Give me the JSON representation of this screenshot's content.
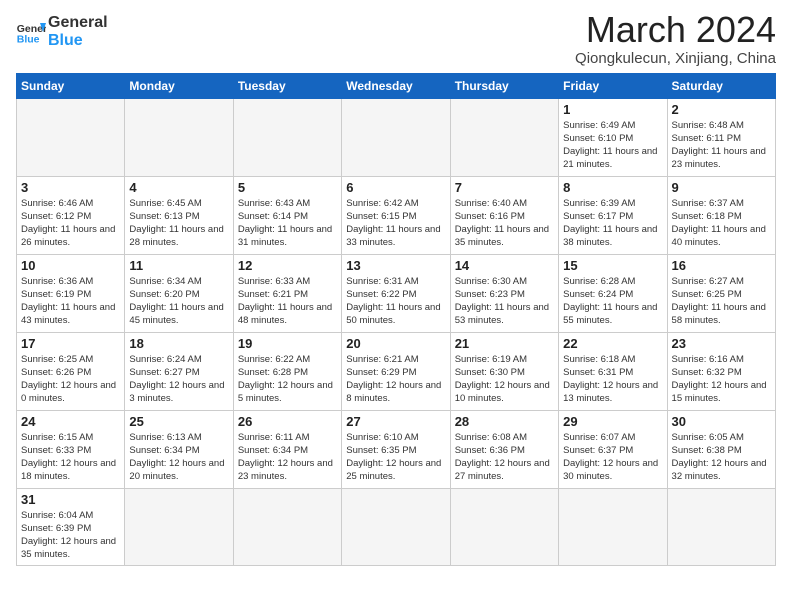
{
  "header": {
    "logo_general": "General",
    "logo_blue": "Blue",
    "month_title": "March 2024",
    "location": "Qiongkulecun, Xinjiang, China"
  },
  "weekdays": [
    "Sunday",
    "Monday",
    "Tuesday",
    "Wednesday",
    "Thursday",
    "Friday",
    "Saturday"
  ],
  "weeks": [
    [
      {
        "day": "",
        "info": ""
      },
      {
        "day": "",
        "info": ""
      },
      {
        "day": "",
        "info": ""
      },
      {
        "day": "",
        "info": ""
      },
      {
        "day": "",
        "info": ""
      },
      {
        "day": "1",
        "info": "Sunrise: 6:49 AM\nSunset: 6:10 PM\nDaylight: 11 hours\nand 21 minutes."
      },
      {
        "day": "2",
        "info": "Sunrise: 6:48 AM\nSunset: 6:11 PM\nDaylight: 11 hours\nand 23 minutes."
      }
    ],
    [
      {
        "day": "3",
        "info": "Sunrise: 6:46 AM\nSunset: 6:12 PM\nDaylight: 11 hours\nand 26 minutes."
      },
      {
        "day": "4",
        "info": "Sunrise: 6:45 AM\nSunset: 6:13 PM\nDaylight: 11 hours\nand 28 minutes."
      },
      {
        "day": "5",
        "info": "Sunrise: 6:43 AM\nSunset: 6:14 PM\nDaylight: 11 hours\nand 31 minutes."
      },
      {
        "day": "6",
        "info": "Sunrise: 6:42 AM\nSunset: 6:15 PM\nDaylight: 11 hours\nand 33 minutes."
      },
      {
        "day": "7",
        "info": "Sunrise: 6:40 AM\nSunset: 6:16 PM\nDaylight: 11 hours\nand 35 minutes."
      },
      {
        "day": "8",
        "info": "Sunrise: 6:39 AM\nSunset: 6:17 PM\nDaylight: 11 hours\nand 38 minutes."
      },
      {
        "day": "9",
        "info": "Sunrise: 6:37 AM\nSunset: 6:18 PM\nDaylight: 11 hours\nand 40 minutes."
      }
    ],
    [
      {
        "day": "10",
        "info": "Sunrise: 6:36 AM\nSunset: 6:19 PM\nDaylight: 11 hours\nand 43 minutes."
      },
      {
        "day": "11",
        "info": "Sunrise: 6:34 AM\nSunset: 6:20 PM\nDaylight: 11 hours\nand 45 minutes."
      },
      {
        "day": "12",
        "info": "Sunrise: 6:33 AM\nSunset: 6:21 PM\nDaylight: 11 hours\nand 48 minutes."
      },
      {
        "day": "13",
        "info": "Sunrise: 6:31 AM\nSunset: 6:22 PM\nDaylight: 11 hours\nand 50 minutes."
      },
      {
        "day": "14",
        "info": "Sunrise: 6:30 AM\nSunset: 6:23 PM\nDaylight: 11 hours\nand 53 minutes."
      },
      {
        "day": "15",
        "info": "Sunrise: 6:28 AM\nSunset: 6:24 PM\nDaylight: 11 hours\nand 55 minutes."
      },
      {
        "day": "16",
        "info": "Sunrise: 6:27 AM\nSunset: 6:25 PM\nDaylight: 11 hours\nand 58 minutes."
      }
    ],
    [
      {
        "day": "17",
        "info": "Sunrise: 6:25 AM\nSunset: 6:26 PM\nDaylight: 12 hours\nand 0 minutes."
      },
      {
        "day": "18",
        "info": "Sunrise: 6:24 AM\nSunset: 6:27 PM\nDaylight: 12 hours\nand 3 minutes."
      },
      {
        "day": "19",
        "info": "Sunrise: 6:22 AM\nSunset: 6:28 PM\nDaylight: 12 hours\nand 5 minutes."
      },
      {
        "day": "20",
        "info": "Sunrise: 6:21 AM\nSunset: 6:29 PM\nDaylight: 12 hours\nand 8 minutes."
      },
      {
        "day": "21",
        "info": "Sunrise: 6:19 AM\nSunset: 6:30 PM\nDaylight: 12 hours\nand 10 minutes."
      },
      {
        "day": "22",
        "info": "Sunrise: 6:18 AM\nSunset: 6:31 PM\nDaylight: 12 hours\nand 13 minutes."
      },
      {
        "day": "23",
        "info": "Sunrise: 6:16 AM\nSunset: 6:32 PM\nDaylight: 12 hours\nand 15 minutes."
      }
    ],
    [
      {
        "day": "24",
        "info": "Sunrise: 6:15 AM\nSunset: 6:33 PM\nDaylight: 12 hours\nand 18 minutes."
      },
      {
        "day": "25",
        "info": "Sunrise: 6:13 AM\nSunset: 6:34 PM\nDaylight: 12 hours\nand 20 minutes."
      },
      {
        "day": "26",
        "info": "Sunrise: 6:11 AM\nSunset: 6:34 PM\nDaylight: 12 hours\nand 23 minutes."
      },
      {
        "day": "27",
        "info": "Sunrise: 6:10 AM\nSunset: 6:35 PM\nDaylight: 12 hours\nand 25 minutes."
      },
      {
        "day": "28",
        "info": "Sunrise: 6:08 AM\nSunset: 6:36 PM\nDaylight: 12 hours\nand 27 minutes."
      },
      {
        "day": "29",
        "info": "Sunrise: 6:07 AM\nSunset: 6:37 PM\nDaylight: 12 hours\nand 30 minutes."
      },
      {
        "day": "30",
        "info": "Sunrise: 6:05 AM\nSunset: 6:38 PM\nDaylight: 12 hours\nand 32 minutes."
      }
    ],
    [
      {
        "day": "31",
        "info": "Sunrise: 6:04 AM\nSunset: 6:39 PM\nDaylight: 12 hours\nand 35 minutes."
      },
      {
        "day": "",
        "info": ""
      },
      {
        "day": "",
        "info": ""
      },
      {
        "day": "",
        "info": ""
      },
      {
        "day": "",
        "info": ""
      },
      {
        "day": "",
        "info": ""
      },
      {
        "day": "",
        "info": ""
      }
    ]
  ]
}
